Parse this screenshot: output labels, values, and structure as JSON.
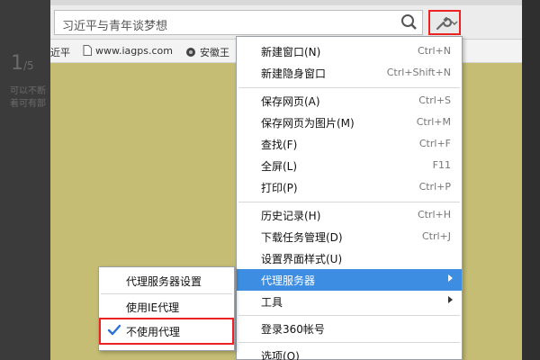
{
  "page_side": {
    "number_main": "1",
    "number_suffix": "/5",
    "line1": "可以不断",
    "line2": "着可有部"
  },
  "browser": {
    "search_text": "习近平与青年谈梦想",
    "bookmarks": [
      {
        "label": "近平"
      },
      {
        "label": "www.iagps.com"
      },
      {
        "label": "安徽王"
      }
    ]
  },
  "menu": {
    "items": [
      {
        "label": "新建窗口(N)",
        "shortcut": "Ctrl+N"
      },
      {
        "label": "新建隐身窗口",
        "shortcut": "Ctrl+Shift+N"
      },
      {
        "label": "保存网页(A)",
        "shortcut": "Ctrl+S"
      },
      {
        "label": "保存网页为图片(M)",
        "shortcut": "Ctrl+M"
      },
      {
        "label": "查找(F)",
        "shortcut": "Ctrl+F"
      },
      {
        "label": "全屏(L)",
        "shortcut": "F11"
      },
      {
        "label": "打印(P)",
        "shortcut": "Ctrl+P"
      },
      {
        "label": "历史记录(H)",
        "shortcut": "Ctrl+H"
      },
      {
        "label": "下载任务管理(D)",
        "shortcut": "Ctrl+J"
      },
      {
        "label": "设置界面样式(U)",
        "shortcut": ""
      },
      {
        "label": "代理服务器",
        "shortcut": ""
      },
      {
        "label": "工具",
        "shortcut": ""
      },
      {
        "label": "登录360帐号",
        "shortcut": ""
      },
      {
        "label": "选项(O)",
        "shortcut": ""
      }
    ]
  },
  "submenu": {
    "items": [
      {
        "label": "代理服务器设置"
      },
      {
        "label": "使用IE代理"
      },
      {
        "label": "不使用代理",
        "checked": true
      }
    ]
  },
  "colors": {
    "highlight": "#3d8ee3",
    "annotation_red": "#e22222",
    "page_background": "#c5bd74"
  }
}
